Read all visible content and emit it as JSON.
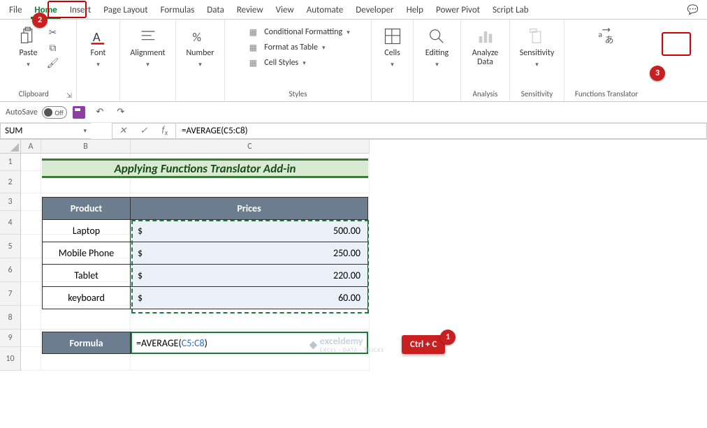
{
  "tabs": [
    "File",
    "Home",
    "Insert",
    "Page Layout",
    "Formulas",
    "Data",
    "Review",
    "View",
    "Automate",
    "Developer",
    "Help",
    "Power Pivot",
    "Script Lab"
  ],
  "ribbon": {
    "clipboard": {
      "title": "Clipboard",
      "paste": "Paste"
    },
    "font": {
      "title": "Font",
      "label": "Font"
    },
    "alignment": {
      "title": "Alignment",
      "label": "Alignment"
    },
    "number": {
      "title": "Number",
      "label": "Number"
    },
    "styles": {
      "title": "Styles",
      "cond": "Conditional Formatting",
      "table": "Format as Table",
      "cell": "Cell Styles"
    },
    "cells": {
      "title": "Cells",
      "label": "Cells"
    },
    "editing": {
      "title": "Editing",
      "label": "Editing"
    },
    "analysis": {
      "title": "Analysis",
      "label": "Analyze Data"
    },
    "sensitivity": {
      "title": "Sensitivity",
      "label": "Sensitivity"
    },
    "ft": {
      "title": "Functions Translator"
    }
  },
  "qat": {
    "autosave": "AutoSave",
    "off": "Off"
  },
  "namebox": "SUM",
  "formula_bar": "=AVERAGE(C5:C8)",
  "title_banner": "Applying Functions Translator Add-in",
  "table": {
    "headers": [
      "Product",
      "Prices"
    ],
    "rows": [
      {
        "product": "Laptop",
        "price": "500.00"
      },
      {
        "product": "Mobile Phone",
        "price": "250.00"
      },
      {
        "product": "Tablet",
        "price": "220.00"
      },
      {
        "product": "keyboard",
        "price": "60.00"
      }
    ],
    "currency": "$"
  },
  "formula_row": {
    "label": "Formula",
    "prefix": "=AVERAGE(",
    "ref": "C5:C8",
    "suffix": ")"
  },
  "columns": [
    "A",
    "B",
    "C"
  ],
  "rownums": [
    "1",
    "2",
    "3",
    "4",
    "5",
    "6",
    "7",
    "8",
    "9",
    "10"
  ],
  "callouts": {
    "b1": "1",
    "b2": "2",
    "b3": "3",
    "kbd": "Ctrl + C"
  },
  "watermark": {
    "main": "exceldemy",
    "sub": "EXCEL · DATA · TRICKS"
  }
}
